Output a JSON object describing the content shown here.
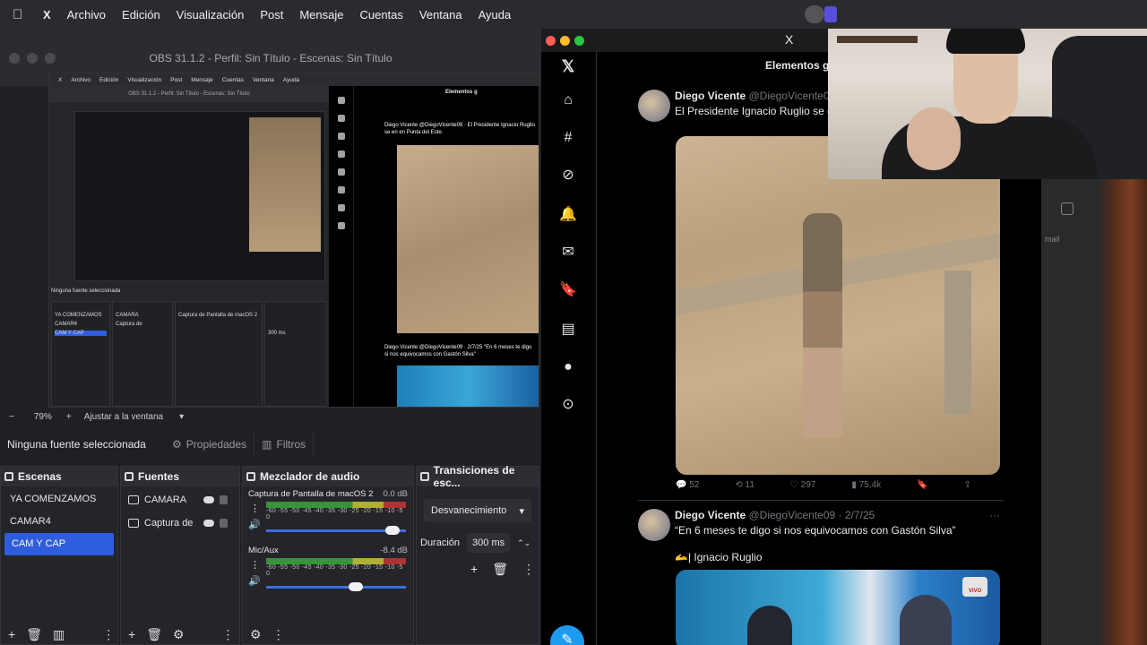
{
  "menubar": {
    "app_name": "X",
    "items": [
      "Archivo",
      "Edición",
      "Visualización",
      "Post",
      "Mensaje",
      "Cuentas",
      "Ventana",
      "Ayuda"
    ]
  },
  "obs": {
    "window_title": "OBS 31.1.2 - Perfil: Sin Título - Escenas: Sin Título",
    "zoom": "79%",
    "fit_label": "Ajustar a la ventana",
    "no_source": "Ninguna fuente seleccionada",
    "properties_label": "Propiedades",
    "filters_label": "Filtros",
    "scenes_title": "Escenas",
    "scenes": [
      "YA COMENZAMOS",
      "CAMAR4",
      "CAM Y CAP"
    ],
    "sources_title": "Fuentes",
    "sources": [
      "CAMARA",
      "Captura de"
    ],
    "mixer_title": "Mezclador de audio",
    "mixer": [
      {
        "name": "Captura de Pantalla de macOS 2",
        "db": "0.0 dB",
        "level": 0.95
      },
      {
        "name": "Mic/Aux",
        "db": "-8.4 dB",
        "level": 0.66
      }
    ],
    "meter_scale": "-60 -55 -50 -45 -40 -35 -30 -25 -20 -15 -10 -5 0",
    "transitions_title": "Transiciones de esc...",
    "transition": "Desvanecimiento",
    "duration_label": "Duración",
    "duration": "300 ms"
  },
  "mini": {
    "menubar": [
      "X",
      "Archivo",
      "Edición",
      "Visualización",
      "Post",
      "Mensaje",
      "Cuentas",
      "Ventana",
      "Ayuda"
    ],
    "title": "OBS 31.1.2 - Perfil: Sin Título - Escenas: Sin Título",
    "tweet1": "Diego Vicente @DiegoVicente09 · El Presidente Ignacio Ruglio se en en Punta del Este.",
    "tweet2": "Diego Vicente @DiegoVicente09 · 2/7/25 \"En 6 meses te digo si nos equivocamos con Gastón Silva\"",
    "scenes": [
      "YA COMENZAMOS",
      "CAMAR4",
      "CAM Y CAP"
    ],
    "sources": [
      "CAMARA",
      "Captura de"
    ],
    "no_source": "Ninguna fuente seleccionada",
    "mixer_name": "Captura de Pantalla de macOS 2",
    "duration": "300 ms",
    "heading": "Elementos g"
  },
  "twitter": {
    "close_label": "X",
    "heading": "Elementos g",
    "tweet1": {
      "name": "Diego Vicente",
      "handle": "@DiegoVicente09",
      "text": "El Presidente Ignacio Ruglio se en en Punta del Este.",
      "replies": "52",
      "retweets": "11",
      "likes": "297",
      "views": "75,4k"
    },
    "tweet2": {
      "name": "Diego Vicente",
      "handle": "@DiegoVicente09 · 2/7/25",
      "text": "“En 6 meses te digo si nos equivocamos con Gastón Silva”",
      "text2": "🫴| Ignacio Ruglio",
      "badge": "VIVO"
    }
  },
  "right_panel": {
    "label": "mail"
  }
}
